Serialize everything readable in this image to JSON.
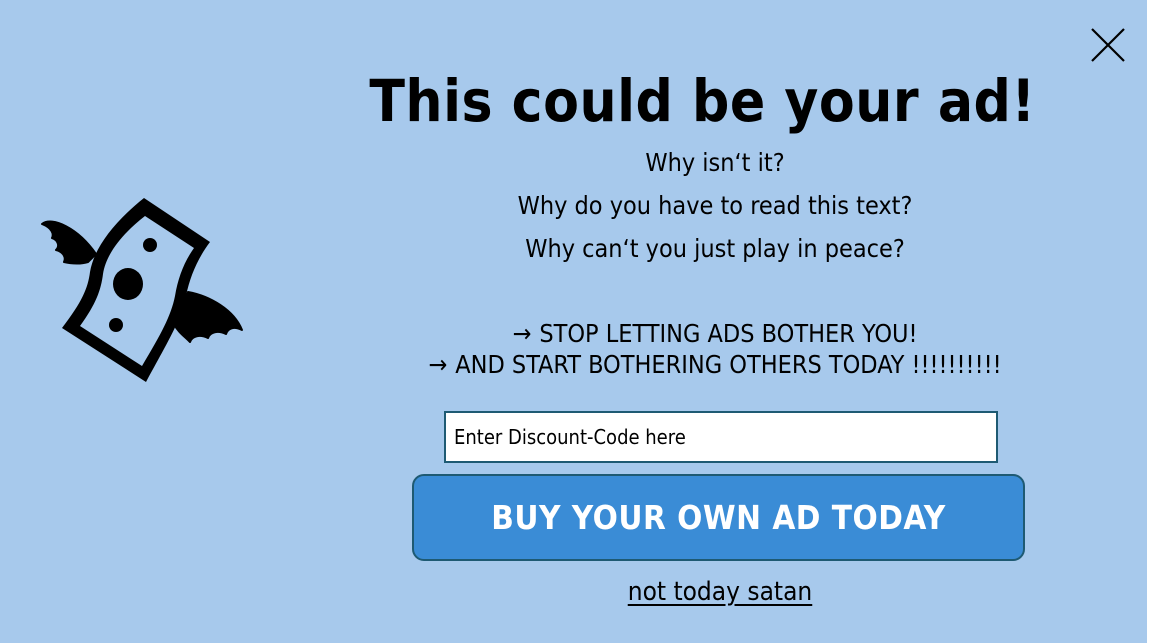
{
  "popup": {
    "headline": "This could be your ad!",
    "questions": [
      "Why isn‘t it?",
      "Why do you have to read this text?",
      "Why can‘t you just play in peace?"
    ],
    "cta_lines": [
      "STOP LETTING ADS BOTHER YOU!",
      "AND START BOTHERING OTHERS TODAY !!!!!!!!!!"
    ],
    "arrow_glyph": "→",
    "discount_input": {
      "placeholder": "Enter Discount-Code here",
      "value": ""
    },
    "buy_button_label": "BUY YOUR OWN AD TODAY",
    "decline_link": "not today satan",
    "icons": {
      "close": "close-icon",
      "logo": "flying-money-icon"
    },
    "colors": {
      "background": "#a7c9ec",
      "button": "#3a8cd6",
      "border": "#1e5a73"
    }
  }
}
